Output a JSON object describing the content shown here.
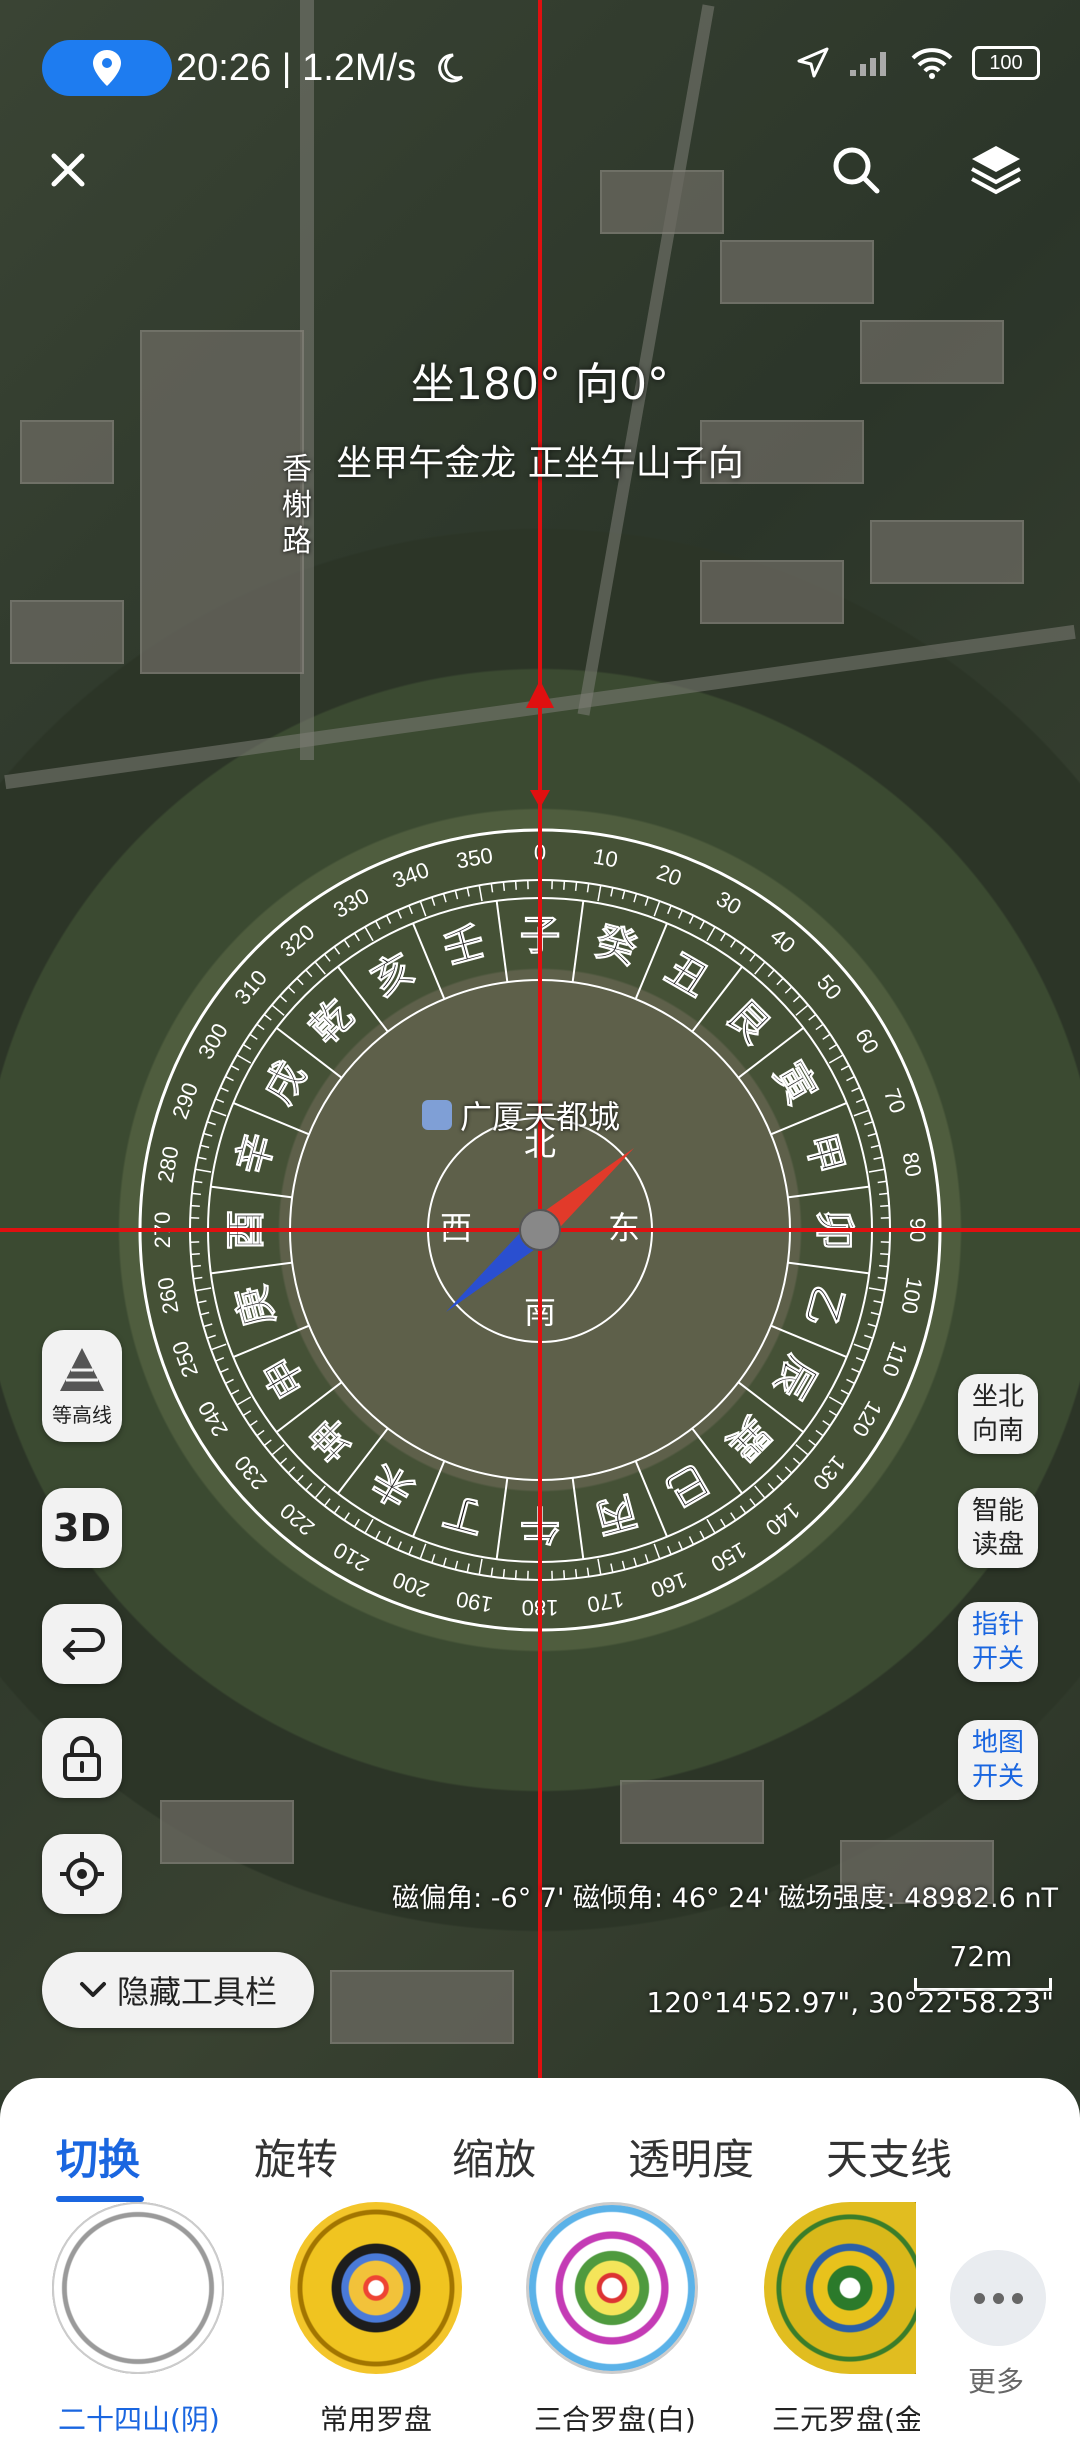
{
  "status_bar": {
    "status_text": "20:26 | 1.2M/s",
    "battery": "100"
  },
  "toolbar": {
    "close_icon": "close-icon",
    "search_icon": "search-icon",
    "layers_icon": "layers-icon"
  },
  "heading": {
    "main": "坐180° 向0°",
    "sub": "坐甲午金龙 正坐午山子向"
  },
  "map_labels": {
    "road": "香榭路",
    "poi": "广厦天都城"
  },
  "compass": {
    "rotation_deg": 0,
    "mountains": [
      "子",
      "癸",
      "丑",
      "艮",
      "寅",
      "甲",
      "卯",
      "乙",
      "辰",
      "巽",
      "巳",
      "丙",
      "午",
      "丁",
      "未",
      "坤",
      "申",
      "庚",
      "酉",
      "辛",
      "戌",
      "乾",
      "亥",
      "壬"
    ],
    "degree_labels": [
      "0",
      "10",
      "20",
      "30",
      "40",
      "50",
      "60",
      "70",
      "80",
      "90",
      "100",
      "110",
      "120",
      "130",
      "140",
      "150",
      "160",
      "170",
      "180",
      "190",
      "200",
      "210",
      "220",
      "230",
      "240",
      "250",
      "260",
      "270",
      "280",
      "290",
      "300",
      "310",
      "320",
      "330",
      "340",
      "350"
    ],
    "directions": {
      "north": "北",
      "south": "南",
      "east": "东",
      "west": "西"
    }
  },
  "left_tools": {
    "contour_label": "等高线",
    "btn_3d_label": "3D"
  },
  "hide_toolbar_label": "隐藏工具栏",
  "right_tools": {
    "sit_north": "坐北\n向南",
    "smart_read": "智能\n读盘",
    "needle_toggle": "指针\n开关",
    "map_toggle": "地图\n开关"
  },
  "info": {
    "magnetic": "磁偏角: -6° 7'  磁倾角: 46° 24'  磁场强度: 48982.6 nT",
    "scale": "72m",
    "coords": "120°14'52.97\", 30°22'58.23\""
  },
  "sheet": {
    "tabs": [
      "切换",
      "旋转",
      "缩放",
      "透明度",
      "天支线"
    ],
    "active_tab": 0,
    "discs": [
      "二十四山(阴)",
      "常用罗盘",
      "三合罗盘(白)",
      "三元罗盘(金"
    ],
    "more_label": "更多"
  },
  "colors": {
    "accent": "#1a66e0",
    "crosshair": "#e01010",
    "needle_north": "#e23a2a",
    "needle_south": "#2a4fd0",
    "pill": "#1e7cf0"
  }
}
